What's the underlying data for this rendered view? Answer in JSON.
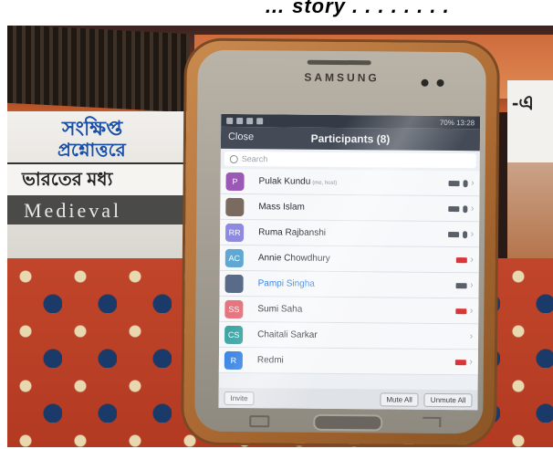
{
  "caption": "… story . . . . . . . .",
  "background": {
    "bengali_line1": "সংক্ষিপ্ত",
    "bengali_line2": "প্রশ্নোত্তরে",
    "bengali_line3": "ভারতের মধ্য",
    "medieval": "Medieval",
    "bengali_right": "-এ"
  },
  "phone": {
    "brand": "SAMSUNG",
    "status": {
      "battery": "70%",
      "time": "13:28"
    },
    "header": {
      "close": "Close",
      "title": "Participants (8)"
    },
    "search_placeholder": "Search",
    "participants": [
      {
        "initial": "P",
        "name": "Pulak Kundu",
        "tag": "(me, host)",
        "avatar_color": "#9b59b6",
        "video": "on",
        "mic": true,
        "active": false
      },
      {
        "initial": "",
        "name": "Mass Islam",
        "tag": "",
        "avatar_color": "#7a6a60",
        "video": "on",
        "mic": true,
        "active": false
      },
      {
        "initial": "RR",
        "name": "Ruma Rajbanshi",
        "tag": "",
        "avatar_color": "#8e8ae0",
        "video": "on",
        "mic": true,
        "active": false
      },
      {
        "initial": "AC",
        "name": "Annie Chowdhury",
        "tag": "",
        "avatar_color": "#5fa8d3",
        "video": "off",
        "mic": false,
        "active": false
      },
      {
        "initial": "",
        "name": "Pampi Singha",
        "tag": "",
        "avatar_color": "#5a6b8a",
        "video": "on",
        "mic": false,
        "active": true
      },
      {
        "initial": "SS",
        "name": "Sumi Saha",
        "tag": "",
        "avatar_color": "#e5757f",
        "video": "off",
        "mic": false,
        "active": false
      },
      {
        "initial": "CS",
        "name": "Chaitali Sarkar",
        "tag": "",
        "avatar_color": "#3aa3a3",
        "video": "none",
        "mic": false,
        "active": false
      },
      {
        "initial": "R",
        "name": "Redmi",
        "tag": "",
        "avatar_color": "#2f7de0",
        "video": "off",
        "mic": false,
        "active": false
      }
    ],
    "footer": {
      "invite": "Invite",
      "mute_all": "Mute All",
      "unmute_all": "Unmute All"
    }
  }
}
